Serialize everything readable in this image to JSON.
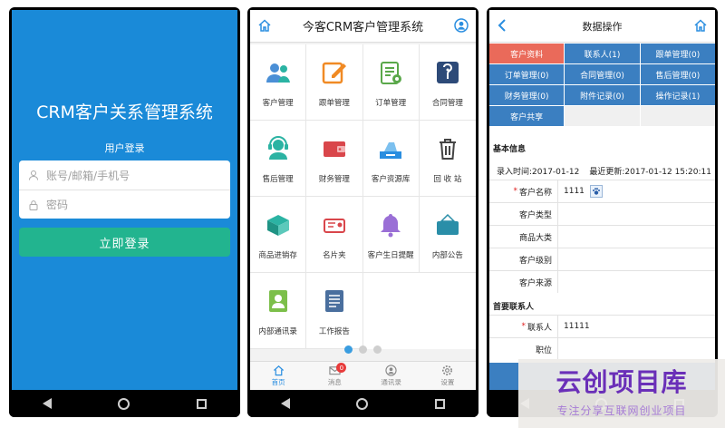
{
  "login": {
    "title": "CRM客户关系管理系统",
    "subtitle": "用户登录",
    "account_placeholder": "账号/邮箱/手机号",
    "password_placeholder": "密码",
    "login_button": "立即登录"
  },
  "dashboard": {
    "title": "今客CRM客户管理系统",
    "modules": [
      {
        "label": "客户管理",
        "icon": "customer-icon"
      },
      {
        "label": "跟单管理",
        "icon": "edit-icon"
      },
      {
        "label": "订单管理",
        "icon": "order-icon"
      },
      {
        "label": "合同管理",
        "icon": "contract-icon"
      },
      {
        "label": "售后管理",
        "icon": "service-icon"
      },
      {
        "label": "财务管理",
        "icon": "wallet-icon"
      },
      {
        "label": "客户资源库",
        "icon": "resource-icon"
      },
      {
        "label": "回 收 站",
        "icon": "trash-icon"
      },
      {
        "label": "商品进销存",
        "icon": "box-icon"
      },
      {
        "label": "名片夹",
        "icon": "card-icon"
      },
      {
        "label": "客户生日提醒",
        "icon": "bell-icon"
      },
      {
        "label": "内部公告",
        "icon": "notice-icon"
      },
      {
        "label": "内部通讯录",
        "icon": "contacts-icon"
      },
      {
        "label": "工作报告",
        "icon": "report-icon"
      }
    ],
    "tabs": [
      {
        "label": "首页",
        "icon": "home-icon"
      },
      {
        "label": "消息",
        "icon": "mail-icon",
        "badge": "0"
      },
      {
        "label": "通讯录",
        "icon": "user-icon"
      },
      {
        "label": "设置",
        "icon": "gear-icon"
      }
    ],
    "page_dots": 3,
    "active_dot": 0
  },
  "data_ops": {
    "title": "数据操作",
    "tabs": [
      {
        "label": "客户资料"
      },
      {
        "label": "联系人(1)"
      },
      {
        "label": "跟单管理(0)"
      },
      {
        "label": "订单管理(0)"
      },
      {
        "label": "合同管理(0)"
      },
      {
        "label": "售后管理(0)"
      },
      {
        "label": "财务管理(0)"
      },
      {
        "label": "附件记录(0)"
      },
      {
        "label": "操作记录(1)"
      },
      {
        "label": "客户共享"
      }
    ],
    "basic_info_title": "基本信息",
    "created_time": "录入时间:2017-01-12",
    "updated_time": "最近更新:2017-01-12 15:20:11",
    "fields": [
      {
        "label": "客户名称",
        "value": "1111",
        "required": true
      },
      {
        "label": "客户类型",
        "value": ""
      },
      {
        "label": "商品大类",
        "value": ""
      },
      {
        "label": "客户级别",
        "value": ""
      },
      {
        "label": "客户来源",
        "value": ""
      }
    ],
    "primary_contact_title": "首要联系人",
    "contact_fields": [
      {
        "label": "联系人",
        "value": "11111",
        "required": true
      },
      {
        "label": "职位",
        "value": ""
      }
    ]
  },
  "watermark": {
    "title": "云创项目库",
    "subtitle": "专注分享互联网创业项目"
  },
  "colors": {
    "login_bg": "#1a8ad8",
    "login_button": "#22b48f",
    "tab_blue": "#3b7fc1",
    "tab_active": "#ea6a5a"
  }
}
